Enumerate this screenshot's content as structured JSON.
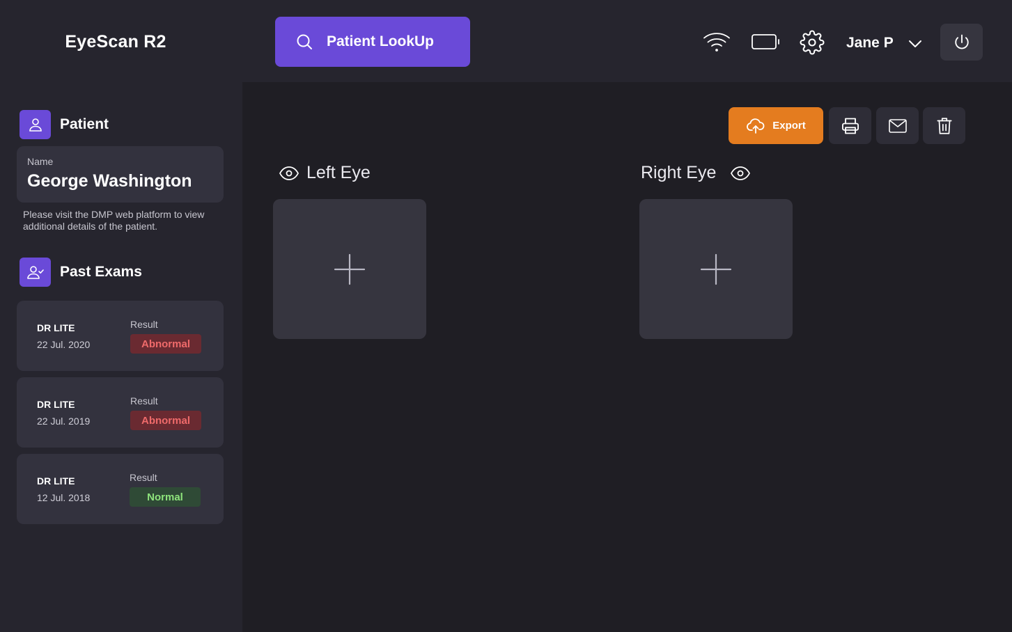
{
  "app": {
    "title": "EyeScan R2"
  },
  "header": {
    "lookup_label": "Patient LookUp",
    "user_name": "Jane P",
    "icons": [
      "wifi-icon",
      "battery-icon",
      "gear-icon",
      "chevron-down-icon",
      "power-icon"
    ]
  },
  "patient": {
    "section_label": "Patient",
    "name_label": "Name",
    "name": "George Washington",
    "note": "Please visit the DMP web platform to view additional details of the patient."
  },
  "past_exams": {
    "section_label": "Past Exams",
    "items": [
      {
        "type": "DR LITE",
        "date": "22 Jul. 2020",
        "result_label": "Result",
        "result": "Abnormal"
      },
      {
        "type": "DR LITE",
        "date": "22 Jul. 2019",
        "result_label": "Result",
        "result": "Abnormal"
      },
      {
        "type": "DR LITE",
        "date": "12 Jul. 2018",
        "result_label": "Result",
        "result": "Normal"
      }
    ]
  },
  "toolbar": {
    "export_label": "Export"
  },
  "eyes": {
    "left_label": "Left Eye",
    "right_label": "Right Eye"
  },
  "colors": {
    "accent": "#6a4ad8",
    "export": "#e47c1f",
    "abnormal": "#ef6a6a",
    "normal": "#8ee47c",
    "background": "#1f1e24",
    "panel": "#26252e"
  }
}
